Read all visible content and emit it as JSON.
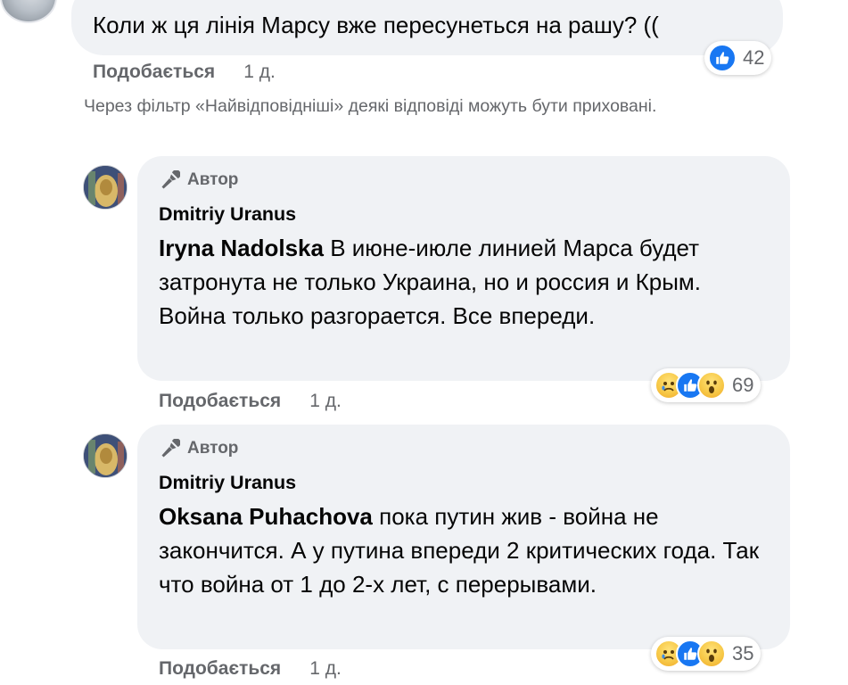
{
  "top_comment": {
    "text": "Коли ж ця лінія Марсу вже пересунеться на рашу? ((",
    "like_label": "Подобається",
    "time": "1 д.",
    "reactions": {
      "icons": [
        "like-icon"
      ],
      "count": "42"
    }
  },
  "filter_note": "Через фільтр «Найвідповідніші» деякі відповіді можуть бути приховані.",
  "replies": [
    {
      "badge": "Автор",
      "author": "Dmitriy Uranus",
      "tag": "Iryna Nadolska",
      "text": " В июне-июле линией Марса будет затронута не только Украина, но и россия и Крым. Война только разгорается. Все впереди.",
      "like_label": "Подобається",
      "time": "1 д.",
      "reactions": {
        "icons": [
          "sad-icon",
          "like-icon",
          "wow-icon"
        ],
        "count": "69"
      }
    },
    {
      "badge": "Автор",
      "author": "Dmitriy Uranus",
      "tag": "Oksana Puhachova",
      "text": " пока путин жив - война не закончится. А у путина впереди 2 критических года. Так что война от 1 до 2-х лет, с перерывами.",
      "like_label": "Подобається",
      "time": "1 д.",
      "reactions": {
        "icons": [
          "sad-icon",
          "like-icon",
          "wow-icon"
        ],
        "count": "35"
      }
    }
  ],
  "colors": {
    "bubble_bg": "#f0f2f5",
    "meta_text": "#65676b",
    "like_blue": "#1877f2",
    "emoji_yellow": "#f7c948"
  }
}
